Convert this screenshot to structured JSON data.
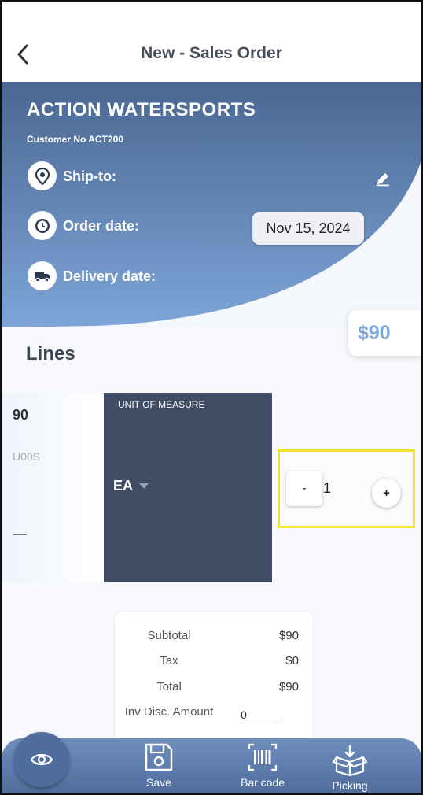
{
  "header": {
    "title": "New - Sales Order",
    "back_icon": "chevron-left-icon"
  },
  "customer": {
    "name": "ACTION WATERSPORTS",
    "number": "Customer No ACT200",
    "ship_to_label": "Ship-to:",
    "order_date_label": "Order date:",
    "order_date_value": "Nov 15, 2024",
    "delivery_date_label": "Delivery date:"
  },
  "order_total": "$90",
  "lines": {
    "title": "Lines",
    "item": {
      "price": "90",
      "code": "U00S",
      "uom_header": "UNIT OF MEASURE",
      "uom_value": "EA",
      "quantity": "1",
      "minus_label": "-",
      "plus_label": "+"
    }
  },
  "summary": {
    "subtotal_label": "Subtotal",
    "subtotal_value": "$90",
    "tax_label": "Tax",
    "tax_value": "$0",
    "total_label": "Total",
    "total_value": "$90",
    "disc_label": "Inv Disc. Amount",
    "disc_value": "0"
  },
  "bottom_nav": {
    "save_label": "Save",
    "barcode_label": "Bar code",
    "picking_label": "Picking"
  },
  "colors": {
    "accent": "#7ea7d8",
    "header_dark": "#4a6791",
    "uom_bg": "#3f4c64",
    "highlight": "#f3e22a"
  }
}
